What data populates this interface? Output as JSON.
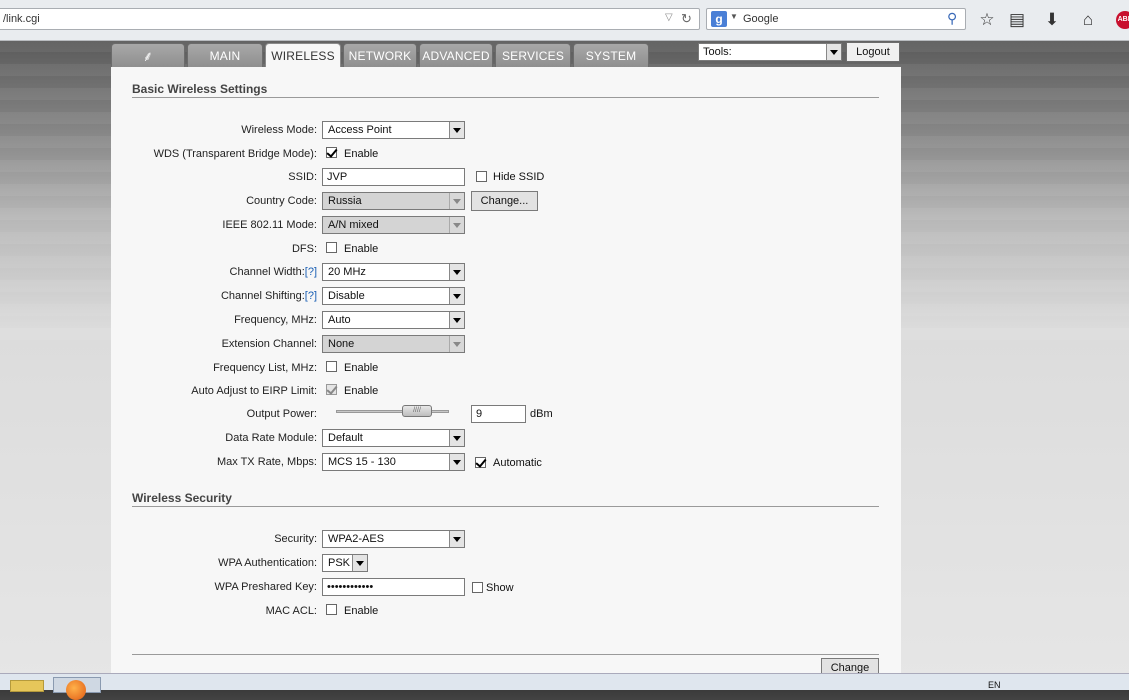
{
  "browser": {
    "url": "/link.cgi",
    "search_engine_icon": "g-icon",
    "search_placeholder": "Google"
  },
  "tabs": [
    {
      "label": "",
      "icon": "ubnt-logo-icon"
    },
    {
      "label": "MAIN"
    },
    {
      "label": "WIRELESS"
    },
    {
      "label": "NETWORK"
    },
    {
      "label": "ADVANCED"
    },
    {
      "label": "SERVICES"
    },
    {
      "label": "SYSTEM"
    }
  ],
  "tools": {
    "value": "Tools:"
  },
  "logout_label": "Logout",
  "basic": {
    "title": "Basic Wireless Settings",
    "wireless_mode": {
      "label": "Wireless Mode:",
      "value": "Access Point"
    },
    "wds": {
      "label": "WDS (Transparent Bridge Mode):",
      "option": "Enable",
      "checked": true
    },
    "ssid": {
      "label": "SSID:",
      "value": "JVP",
      "hide_label": "Hide SSID"
    },
    "country": {
      "label": "Country Code:",
      "value": "Russia",
      "button": "Change..."
    },
    "ieee": {
      "label": "IEEE 802.11 Mode:",
      "value": "A/N mixed"
    },
    "dfs": {
      "label": "DFS:",
      "option": "Enable"
    },
    "channel_width": {
      "label": "Channel Width:",
      "help": "[?]",
      "value": "20 MHz"
    },
    "channel_shifting": {
      "label": "Channel Shifting:",
      "help": "[?]",
      "value": "Disable"
    },
    "frequency": {
      "label": "Frequency, MHz:",
      "value": "Auto"
    },
    "extension": {
      "label": "Extension Channel:",
      "value": "None"
    },
    "freq_list": {
      "label": "Frequency List, MHz:",
      "option": "Enable"
    },
    "auto_adjust": {
      "label": "Auto Adjust to EIRP Limit:",
      "option": "Enable",
      "checked": true
    },
    "output_power": {
      "label": "Output Power:",
      "value": "9",
      "unit": "dBm"
    },
    "data_rate": {
      "label": "Data Rate Module:",
      "value": "Default"
    },
    "max_tx": {
      "label": "Max TX Rate, Mbps:",
      "value": "MCS 15 - 130",
      "option": "Automatic",
      "checked": true
    }
  },
  "security": {
    "title": "Wireless Security",
    "security": {
      "label": "Security:",
      "value": "WPA2-AES"
    },
    "wpa_auth": {
      "label": "WPA Authentication:",
      "value": "PSK"
    },
    "wpa_key": {
      "label": "WPA Preshared Key:",
      "value": "••••••••••••",
      "show_label": "Show"
    },
    "mac_acl": {
      "label": "MAC ACL:",
      "option": "Enable"
    }
  },
  "change_label": "Change",
  "taskbar": {
    "lang": "EN"
  }
}
